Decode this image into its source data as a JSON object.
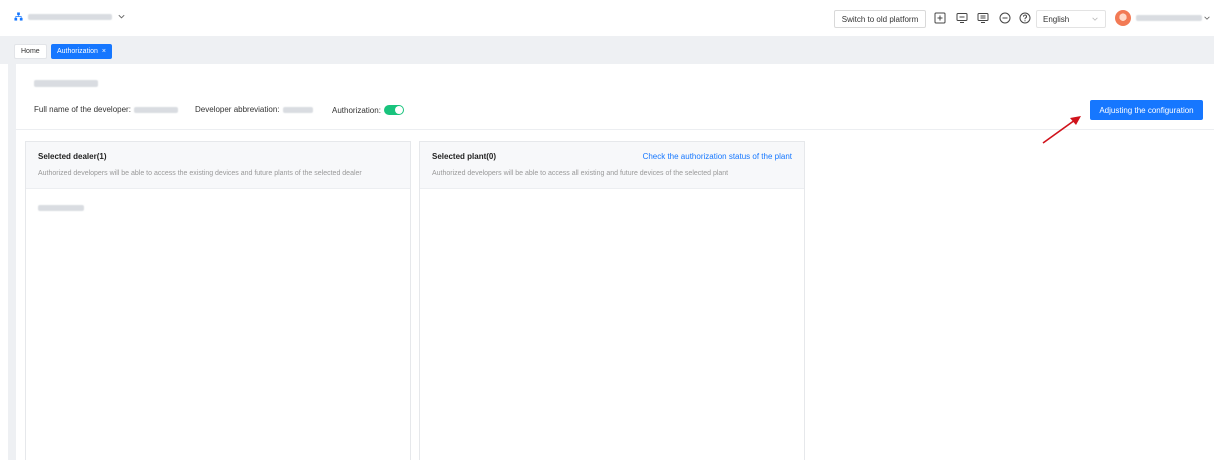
{
  "topbar": {
    "switch_label": "Switch to old platform",
    "tool_icons": [
      "plus-square-icon",
      "monitor-icon",
      "screen-list-icon",
      "minus-circle-icon",
      "help-circle-icon"
    ],
    "language": "English"
  },
  "tabs": [
    {
      "label": "Home",
      "active": false
    },
    {
      "label": "Authorization",
      "active": true,
      "close": "×"
    }
  ],
  "info": {
    "full_name_label": "Full name of the developer:",
    "abbreviation_label": "Developer abbreviation:",
    "authorization_label": "Authorization:",
    "authorization_enabled": true,
    "adjust_label": "Adjusting the configuration"
  },
  "panels": {
    "dealer": {
      "title": "Selected dealer(1)",
      "desc": "Authorized developers will be able to access the existing devices and future plants of the selected dealer"
    },
    "plant": {
      "title": "Selected plant(0)",
      "link": "Check the authorization status of the plant",
      "desc": "Authorized developers will be able to access all existing and future devices of the selected plant"
    }
  },
  "colors": {
    "primary": "#1677ff",
    "toggle_on": "#19c37d",
    "annotation_arrow": "#d0121b"
  }
}
